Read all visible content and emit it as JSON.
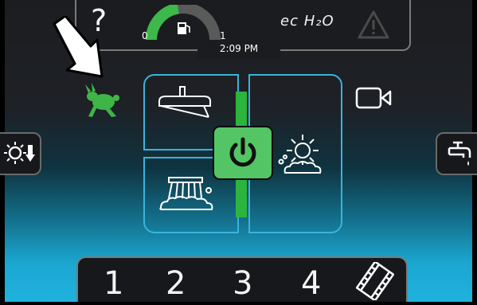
{
  "status_bar": {
    "help_glyph": "?",
    "fuel_min": "0",
    "fuel_max": "1",
    "fuel_level_fraction": 0.45,
    "time": "2:09 PM",
    "ech2o_label": "ec H₂O"
  },
  "speed_mode": {
    "icon": "rabbit-icon",
    "color": "#3fb548"
  },
  "side_buttons": {
    "left": "sun-down-arrow-icon",
    "right": "water-faucet-icon"
  },
  "panel": {
    "accent": "#3ab3dc",
    "power_color": "#54c564",
    "rail_color": "#2cb53c"
  },
  "presets": {
    "p1": "1",
    "p2": "2",
    "p3": "3",
    "p4": "4"
  },
  "video_icon": "film-icon",
  "pointer": "arrow-annotation"
}
